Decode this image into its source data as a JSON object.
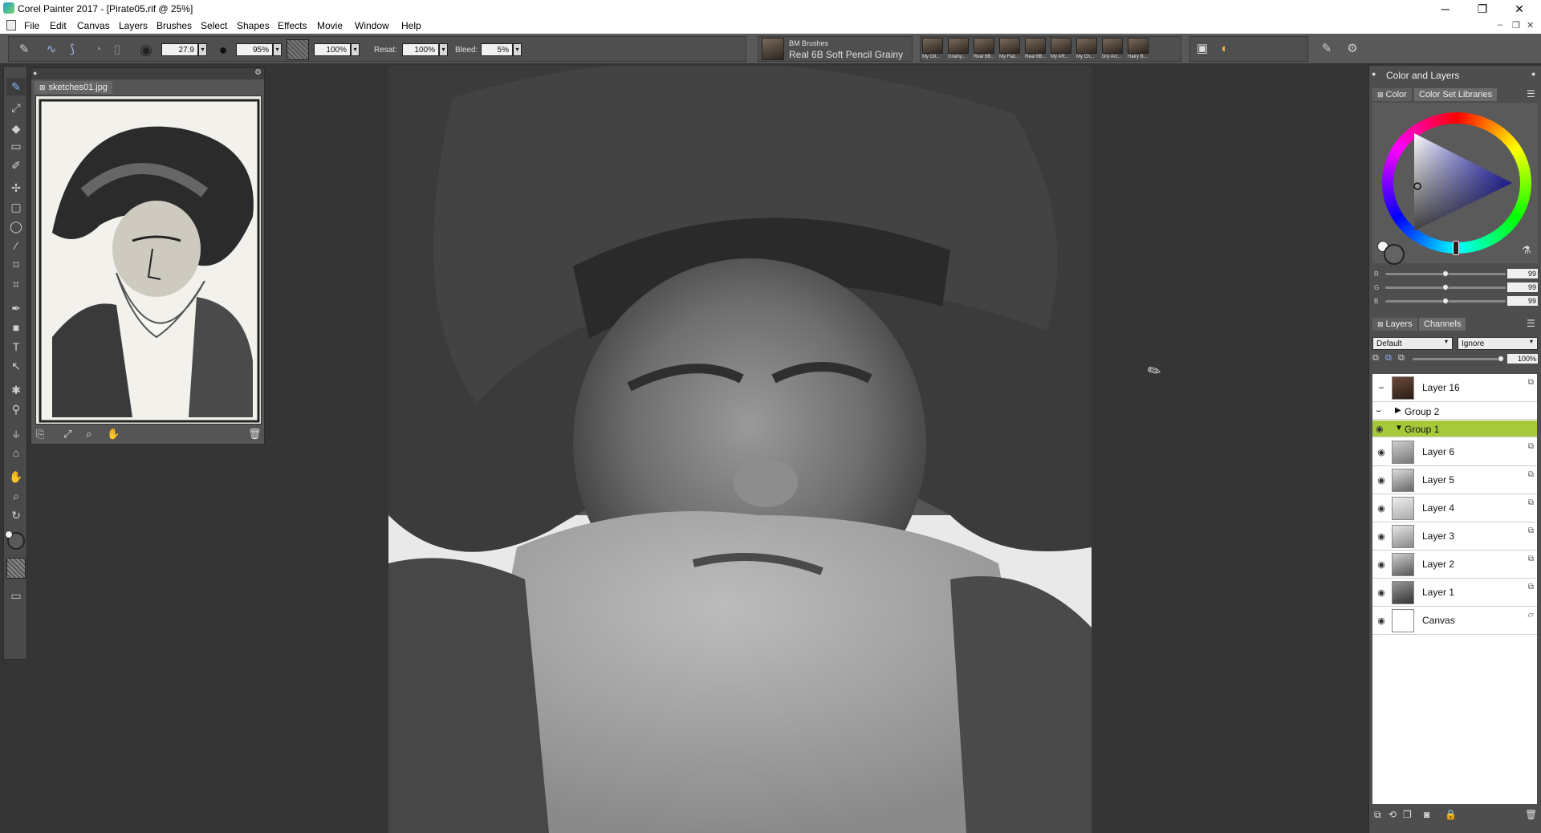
{
  "window": {
    "title": "Corel Painter 2017 - [Pirate05.rif @ 25%]",
    "minimize": "─",
    "restore": "❐",
    "close": "✕"
  },
  "menu": {
    "items": [
      "File",
      "Edit",
      "Canvas",
      "Layers",
      "Brushes",
      "Select",
      "Shapes",
      "Effects",
      "Movie",
      "Window",
      "Help"
    ],
    "doc_minimize": "‒",
    "doc_restore": "❐",
    "doc_close": "✕"
  },
  "propbar": {
    "size_value": "27.9",
    "opacity_value": "95%",
    "grain_value": "100%",
    "resat_label": "Resat:",
    "resat_value": "100%",
    "bleed_label": "Bleed:",
    "bleed_value": "5%",
    "brush_category": "BM Brushes",
    "brush_variant": "Real 6B Soft Pencil Grainy",
    "recent_brushes": [
      "My Oil...",
      "Grainy...",
      "Real 6B...",
      "My Flat...",
      "Real 6B...",
      "My AR...",
      "My Ch...",
      "Dry Acr...",
      "Hairy B..."
    ]
  },
  "reference": {
    "tab_label": "sketches01.jpg"
  },
  "color_panel": {
    "header": "Color and Layers",
    "tab_color": "Color",
    "tab_libraries": "Color Set Libraries",
    "r_label": "R",
    "g_label": "G",
    "b_label": "B",
    "r_value": "99",
    "g_value": "99",
    "b_value": "99",
    "r_level": 0.5,
    "g_level": 0.5,
    "b_level": 0.5,
    "current_color": "#636363"
  },
  "layers_panel": {
    "tab_layers": "Layers",
    "tab_channels": "Channels",
    "composite_method": "Default",
    "composite_depth": "Ignore",
    "opacity": "100%",
    "layers": [
      {
        "name": "Layer 16"
      },
      {
        "name": "Group 2"
      },
      {
        "name": "Group 1"
      },
      {
        "name": "Layer 6"
      },
      {
        "name": "Layer 5"
      },
      {
        "name": "Layer 4"
      },
      {
        "name": "Layer 3"
      },
      {
        "name": "Layer 2"
      },
      {
        "name": "Layer 1"
      },
      {
        "name": "Canvas"
      }
    ],
    "selected_color": "#a6c93a"
  }
}
